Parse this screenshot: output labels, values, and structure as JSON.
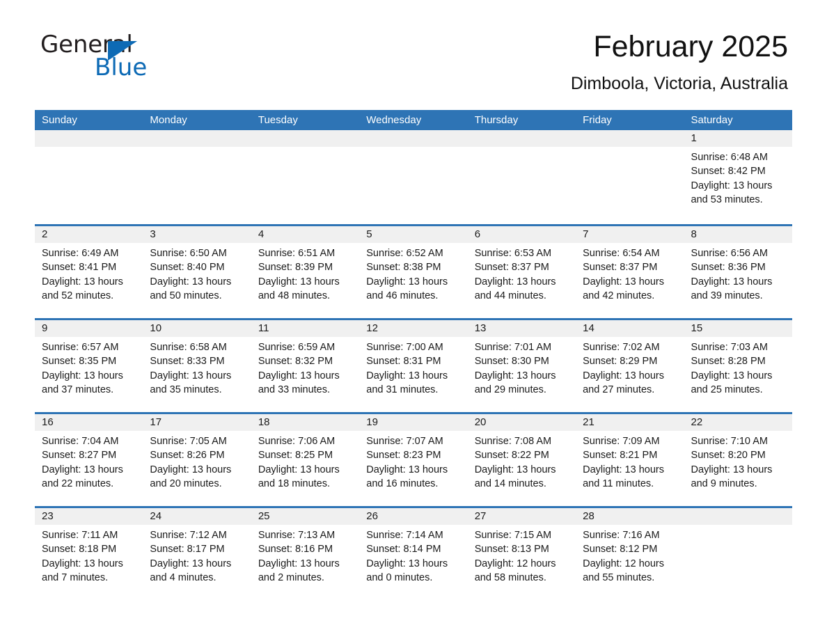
{
  "brand": {
    "logo_text_1": "General",
    "logo_text_2": "Blue",
    "logo_triangle_color": "#0d6ab5",
    "logo_text_1_color": "#231f20"
  },
  "header": {
    "title": "February 2025",
    "subtitle": "Dimboola, Victoria, Australia",
    "header_bg_color": "#2e74b5",
    "daynum_bg_color": "#f0f0f0"
  },
  "calendar": {
    "weekday_headers": [
      "Sunday",
      "Monday",
      "Tuesday",
      "Wednesday",
      "Thursday",
      "Friday",
      "Saturday"
    ],
    "labels": {
      "sunrise": "Sunrise:",
      "sunset": "Sunset:",
      "daylight": "Daylight:"
    },
    "weeks": [
      [
        {
          "day": "",
          "sunrise": "",
          "sunset": "",
          "daylight": ""
        },
        {
          "day": "",
          "sunrise": "",
          "sunset": "",
          "daylight": ""
        },
        {
          "day": "",
          "sunrise": "",
          "sunset": "",
          "daylight": ""
        },
        {
          "day": "",
          "sunrise": "",
          "sunset": "",
          "daylight": ""
        },
        {
          "day": "",
          "sunrise": "",
          "sunset": "",
          "daylight": ""
        },
        {
          "day": "",
          "sunrise": "",
          "sunset": "",
          "daylight": ""
        },
        {
          "day": "1",
          "sunrise": "Sunrise: 6:48 AM",
          "sunset": "Sunset: 8:42 PM",
          "daylight": "Daylight: 13 hours and 53 minutes."
        }
      ],
      [
        {
          "day": "2",
          "sunrise": "Sunrise: 6:49 AM",
          "sunset": "Sunset: 8:41 PM",
          "daylight": "Daylight: 13 hours and 52 minutes."
        },
        {
          "day": "3",
          "sunrise": "Sunrise: 6:50 AM",
          "sunset": "Sunset: 8:40 PM",
          "daylight": "Daylight: 13 hours and 50 minutes."
        },
        {
          "day": "4",
          "sunrise": "Sunrise: 6:51 AM",
          "sunset": "Sunset: 8:39 PM",
          "daylight": "Daylight: 13 hours and 48 minutes."
        },
        {
          "day": "5",
          "sunrise": "Sunrise: 6:52 AM",
          "sunset": "Sunset: 8:38 PM",
          "daylight": "Daylight: 13 hours and 46 minutes."
        },
        {
          "day": "6",
          "sunrise": "Sunrise: 6:53 AM",
          "sunset": "Sunset: 8:37 PM",
          "daylight": "Daylight: 13 hours and 44 minutes."
        },
        {
          "day": "7",
          "sunrise": "Sunrise: 6:54 AM",
          "sunset": "Sunset: 8:37 PM",
          "daylight": "Daylight: 13 hours and 42 minutes."
        },
        {
          "day": "8",
          "sunrise": "Sunrise: 6:56 AM",
          "sunset": "Sunset: 8:36 PM",
          "daylight": "Daylight: 13 hours and 39 minutes."
        }
      ],
      [
        {
          "day": "9",
          "sunrise": "Sunrise: 6:57 AM",
          "sunset": "Sunset: 8:35 PM",
          "daylight": "Daylight: 13 hours and 37 minutes."
        },
        {
          "day": "10",
          "sunrise": "Sunrise: 6:58 AM",
          "sunset": "Sunset: 8:33 PM",
          "daylight": "Daylight: 13 hours and 35 minutes."
        },
        {
          "day": "11",
          "sunrise": "Sunrise: 6:59 AM",
          "sunset": "Sunset: 8:32 PM",
          "daylight": "Daylight: 13 hours and 33 minutes."
        },
        {
          "day": "12",
          "sunrise": "Sunrise: 7:00 AM",
          "sunset": "Sunset: 8:31 PM",
          "daylight": "Daylight: 13 hours and 31 minutes."
        },
        {
          "day": "13",
          "sunrise": "Sunrise: 7:01 AM",
          "sunset": "Sunset: 8:30 PM",
          "daylight": "Daylight: 13 hours and 29 minutes."
        },
        {
          "day": "14",
          "sunrise": "Sunrise: 7:02 AM",
          "sunset": "Sunset: 8:29 PM",
          "daylight": "Daylight: 13 hours and 27 minutes."
        },
        {
          "day": "15",
          "sunrise": "Sunrise: 7:03 AM",
          "sunset": "Sunset: 8:28 PM",
          "daylight": "Daylight: 13 hours and 25 minutes."
        }
      ],
      [
        {
          "day": "16",
          "sunrise": "Sunrise: 7:04 AM",
          "sunset": "Sunset: 8:27 PM",
          "daylight": "Daylight: 13 hours and 22 minutes."
        },
        {
          "day": "17",
          "sunrise": "Sunrise: 7:05 AM",
          "sunset": "Sunset: 8:26 PM",
          "daylight": "Daylight: 13 hours and 20 minutes."
        },
        {
          "day": "18",
          "sunrise": "Sunrise: 7:06 AM",
          "sunset": "Sunset: 8:25 PM",
          "daylight": "Daylight: 13 hours and 18 minutes."
        },
        {
          "day": "19",
          "sunrise": "Sunrise: 7:07 AM",
          "sunset": "Sunset: 8:23 PM",
          "daylight": "Daylight: 13 hours and 16 minutes."
        },
        {
          "day": "20",
          "sunrise": "Sunrise: 7:08 AM",
          "sunset": "Sunset: 8:22 PM",
          "daylight": "Daylight: 13 hours and 14 minutes."
        },
        {
          "day": "21",
          "sunrise": "Sunrise: 7:09 AM",
          "sunset": "Sunset: 8:21 PM",
          "daylight": "Daylight: 13 hours and 11 minutes."
        },
        {
          "day": "22",
          "sunrise": "Sunrise: 7:10 AM",
          "sunset": "Sunset: 8:20 PM",
          "daylight": "Daylight: 13 hours and 9 minutes."
        }
      ],
      [
        {
          "day": "23",
          "sunrise": "Sunrise: 7:11 AM",
          "sunset": "Sunset: 8:18 PM",
          "daylight": "Daylight: 13 hours and 7 minutes."
        },
        {
          "day": "24",
          "sunrise": "Sunrise: 7:12 AM",
          "sunset": "Sunset: 8:17 PM",
          "daylight": "Daylight: 13 hours and 4 minutes."
        },
        {
          "day": "25",
          "sunrise": "Sunrise: 7:13 AM",
          "sunset": "Sunset: 8:16 PM",
          "daylight": "Daylight: 13 hours and 2 minutes."
        },
        {
          "day": "26",
          "sunrise": "Sunrise: 7:14 AM",
          "sunset": "Sunset: 8:14 PM",
          "daylight": "Daylight: 13 hours and 0 minutes."
        },
        {
          "day": "27",
          "sunrise": "Sunrise: 7:15 AM",
          "sunset": "Sunset: 8:13 PM",
          "daylight": "Daylight: 12 hours and 58 minutes."
        },
        {
          "day": "28",
          "sunrise": "Sunrise: 7:16 AM",
          "sunset": "Sunset: 8:12 PM",
          "daylight": "Daylight: 12 hours and 55 minutes."
        },
        {
          "day": "",
          "sunrise": "",
          "sunset": "",
          "daylight": ""
        }
      ]
    ]
  }
}
